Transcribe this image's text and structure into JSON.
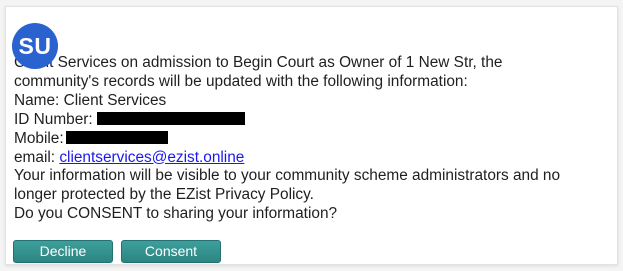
{
  "avatar": {
    "initials": "SU",
    "color": "#2a62cf"
  },
  "message": {
    "line1": "Client Services on admission to Begin Court as Owner of 1 New Str, the",
    "line2": "community's records will be updated with the following information:",
    "name_line": "Name: Client Services",
    "id_label": "ID Number:",
    "mobile_label": "Mobile:",
    "email_label": "email:",
    "email_value": "clientservices@ezist.online",
    "visibility_line1": "Your information will be visible to your community scheme administrators and no",
    "visibility_line2": "longer protected by the EZist Privacy Policy.",
    "consent_question": "Do you CONSENT to sharing your information?"
  },
  "buttons": {
    "decline_label": "Decline",
    "consent_label": "Consent",
    "color": "#2c8682"
  }
}
